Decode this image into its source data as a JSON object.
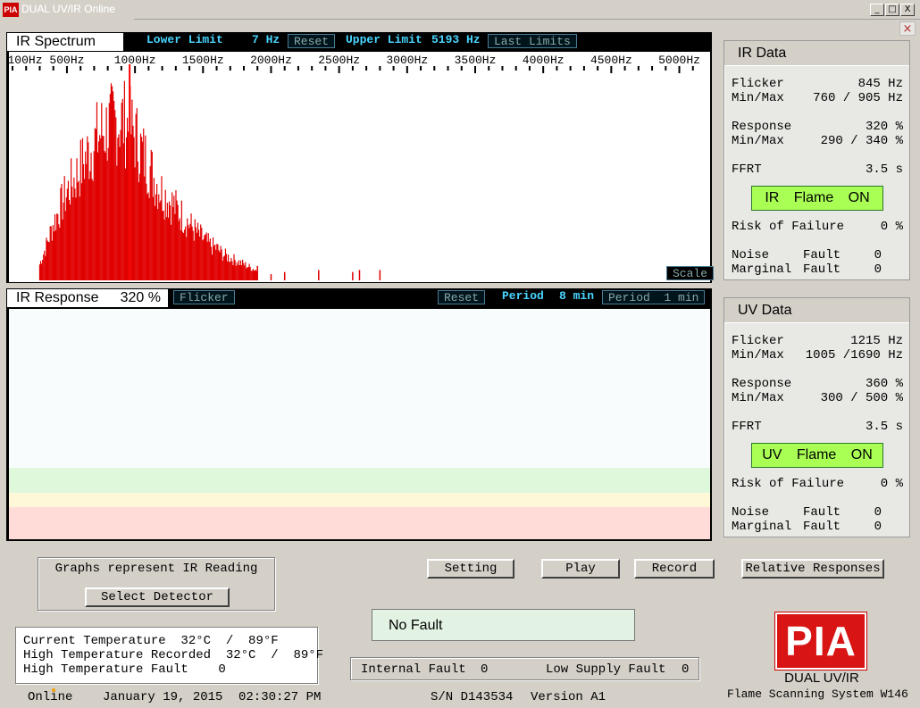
{
  "window": {
    "title": "DUAL UV/IR Online",
    "app_icon": "PIA",
    "minimize": "_",
    "maximize": "□",
    "close": "X",
    "inner_close": "×"
  },
  "spectrum": {
    "tab": "IR Spectrum",
    "lower_limit_label": "Lower Limit",
    "lower_limit_value": "7 Hz",
    "reset": "Reset",
    "upper_limit_label": "Upper Limit",
    "upper_limit_value": "5193 Hz",
    "last_limits": "Last Limits",
    "scale": "Scale",
    "ticks": [
      "100Hz",
      "500Hz",
      "1000Hz",
      "1500Hz",
      "2000Hz",
      "2500Hz",
      "3000Hz",
      "3500Hz",
      "4000Hz",
      "4500Hz",
      "5000Hz"
    ]
  },
  "chart_data": [
    {
      "type": "bar",
      "title": "IR Spectrum",
      "x_unit": "Hz",
      "xlim": [
        100,
        5200
      ],
      "marker_hz": 1000,
      "bar_color": "#e00000",
      "series_envelope": {
        "x": [
          300,
          350,
          400,
          450,
          500,
          550,
          600,
          650,
          700,
          750,
          800,
          850,
          900,
          950,
          1000,
          1050,
          1100,
          1150,
          1200,
          1250,
          1300,
          1350,
          1400,
          1450,
          1500,
          1550,
          1600,
          1650,
          1700,
          1750,
          1800,
          1850,
          1900,
          2000,
          2100,
          2350,
          2600,
          2650,
          2800
        ],
        "y": [
          0.1,
          0.22,
          0.35,
          0.45,
          0.55,
          0.62,
          0.7,
          0.78,
          0.85,
          0.92,
          0.95,
          0.98,
          1.0,
          0.96,
          0.9,
          0.8,
          0.72,
          0.62,
          0.55,
          0.5,
          0.45,
          0.4,
          0.35,
          0.3,
          0.26,
          0.22,
          0.2,
          0.16,
          0.14,
          0.12,
          0.1,
          0.08,
          0.06,
          0.03,
          0.03,
          0.05,
          0.04,
          0.05,
          0.05
        ]
      }
    },
    {
      "type": "line",
      "title": "IR Response",
      "line_color": "#0a0a9a",
      "period_min": 8,
      "zones": [
        {
          "name": "green",
          "color": "#dff7da"
        },
        {
          "name": "yellow",
          "color": "#fff8d8"
        },
        {
          "name": "red",
          "color": "#ffdcd8"
        }
      ]
    }
  ],
  "response": {
    "tab_label": "IR Response",
    "tab_value": "320 %",
    "flicker": "Flicker",
    "reset": "Reset",
    "period_label": "Period",
    "period_value": "8 min",
    "period_btn": "Period  1 min"
  },
  "ir_data": {
    "title": "IR Data",
    "flicker_label": "Flicker",
    "flicker_value": "845 Hz",
    "minmax_label": "Min/Max",
    "flicker_minmax": "760 / 905 Hz",
    "response_label": "Response",
    "response_value": "320 %",
    "response_minmax": "290 / 340 %",
    "ffrt_label": "FFRT",
    "ffrt_value": "3.5 s",
    "flame": "IR Flame ON",
    "risk_label": "Risk of Failure",
    "risk_value": "0 %",
    "noise_label": "Noise",
    "noise_fault": "Fault",
    "noise_value": "0",
    "marginal_label": "Marginal",
    "marginal_fault": "Fault",
    "marginal_value": "0"
  },
  "uv_data": {
    "title": "UV Data",
    "flicker_label": "Flicker",
    "flicker_value": "1215 Hz",
    "minmax_label": "Min/Max",
    "flicker_minmax": "1005 /1690 Hz",
    "response_label": "Response",
    "response_value": "360 %",
    "response_minmax": "300 / 500 %",
    "ffrt_label": "FFRT",
    "ffrt_value": "3.5 s",
    "flame": "UV Flame ON",
    "risk_label": "Risk of Failure",
    "risk_value": "0 %",
    "noise_label": "Noise",
    "noise_fault": "Fault",
    "noise_value": "0",
    "marginal_label": "Marginal",
    "marginal_fault": "Fault",
    "marginal_value": "0"
  },
  "controls": {
    "graphs_note": "Graphs represent IR Reading",
    "select_detector": "Select Detector",
    "setting": "Setting",
    "play": "Play",
    "record": "Record",
    "relative_responses": "Relative Responses"
  },
  "status": {
    "fault_text": "No Fault",
    "current_temp": "Current Temperature  32°C  /  89°F",
    "high_temp_recorded": "High Temperature Recorded  32°C  /  89°F",
    "high_temp_fault": "High Temperature Fault    0",
    "internal_fault_label": "Internal Fault",
    "internal_fault_value": "0",
    "low_supply_label": "Low Supply Fault",
    "low_supply_value": "0",
    "online": "Online",
    "date": "January 19, 2015",
    "time": "02:30:27 PM",
    "serial": "S/N D143534",
    "version": "Version A1"
  },
  "brand": {
    "logo": "PIA",
    "line1": "DUAL UV/IR",
    "line2": "Flame Scanning System W146"
  },
  "colors": {
    "accent_cyan": "#49d6ff",
    "flame_green": "#aaff55",
    "spectrum_red": "#e00000",
    "response_blue": "#0a0a9a"
  }
}
